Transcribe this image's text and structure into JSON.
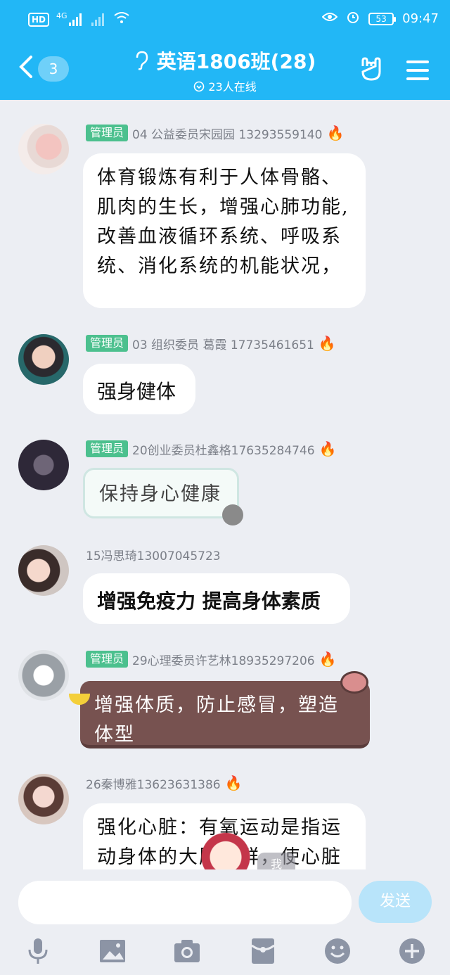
{
  "status_bar": {
    "hd_label": "HD",
    "network": "4G",
    "battery": "53",
    "time": "09:47"
  },
  "header": {
    "back_count": "3",
    "title": "英语1806班(28)",
    "online": "23人在线"
  },
  "messages": [
    {
      "admin_label": "管理员",
      "sender": "04 公益委员宋园园 13293559140",
      "text": "体育锻炼有利于人体骨骼、肌肉的生长，增强心肺功能,改善血液循环系统、呼吸系统、消化系统的机能状况，"
    },
    {
      "admin_label": "管理员",
      "sender": "03 组织委员 葛霞 17735461651",
      "text": "强身健体"
    },
    {
      "admin_label": "管理员",
      "sender": "20创业委员杜鑫格17635284746",
      "text": "保持身心健康"
    },
    {
      "sender": "15冯思琦13007045723",
      "text": "增强免疫力 提高身体素质"
    },
    {
      "admin_label": "管理员",
      "sender": "29心理委员许艺林18935297206",
      "text": "增强体质，防止感冒，塑造体型"
    },
    {
      "sender": "26秦博雅13623631386",
      "text": "强化心脏：有氧运动是指运动身体的大肌肉群，使心脏"
    }
  ],
  "self_tag": "我",
  "composer": {
    "send_label": "发送"
  },
  "colors": {
    "header_bg": "#22b7f6",
    "admin_badge": "#4cc08e",
    "brown_bubble": "#775250"
  },
  "toolbar_icons": [
    "microphone-icon",
    "image-icon",
    "camera-icon",
    "red-packet-icon",
    "emoji-icon",
    "plus-icon"
  ]
}
